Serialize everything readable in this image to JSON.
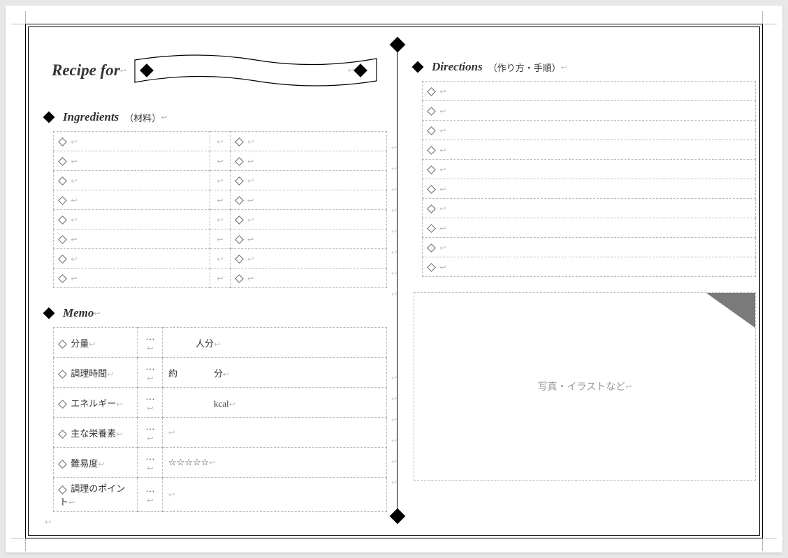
{
  "header": {
    "recipe_for": "Recipe for",
    "title_value": ""
  },
  "ingredients": {
    "heading_en": "Ingredients",
    "heading_jp": "（材料）",
    "rows": [
      {
        "left": "",
        "right": ""
      },
      {
        "left": "",
        "right": ""
      },
      {
        "left": "",
        "right": ""
      },
      {
        "left": "",
        "right": ""
      },
      {
        "left": "",
        "right": ""
      },
      {
        "left": "",
        "right": ""
      },
      {
        "left": "",
        "right": ""
      },
      {
        "left": "",
        "right": ""
      }
    ]
  },
  "memo": {
    "heading_en": "Memo",
    "rows": [
      {
        "label": "分量",
        "dots": "…",
        "value": "　　　人分"
      },
      {
        "label": "調理時間",
        "dots": "…",
        "value": "約　　　　分"
      },
      {
        "label": "エネルギー",
        "dots": "…",
        "value": "　　　　　kcal"
      },
      {
        "label": "主な栄養素",
        "dots": "…",
        "value": ""
      },
      {
        "label": "難易度",
        "dots": "…",
        "value": "☆☆☆☆☆"
      },
      {
        "label": "調理のポイント",
        "dots": "…",
        "value": ""
      }
    ]
  },
  "directions": {
    "heading_en": "Directions",
    "heading_jp": "（作り方・手順）",
    "rows": [
      "",
      "",
      "",
      "",
      "",
      "",
      "",
      "",
      "",
      ""
    ]
  },
  "photo": {
    "placeholder": "写真・イラストなど"
  }
}
